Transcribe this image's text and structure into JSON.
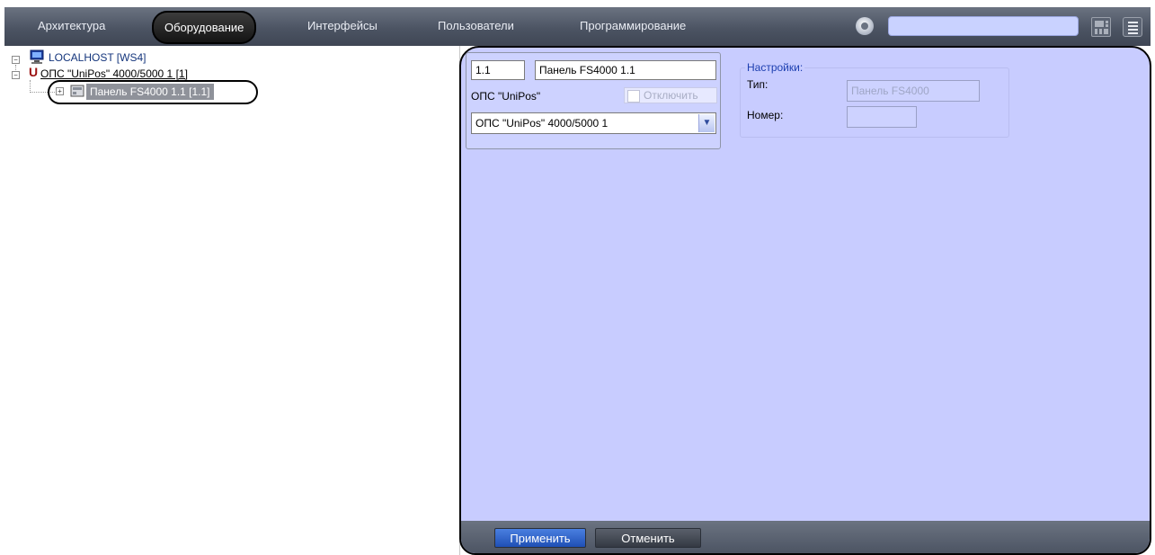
{
  "topbar": {
    "tabs": [
      {
        "label": "Архитектура"
      },
      {
        "label": "Оборудование"
      },
      {
        "label": "Интерфейсы"
      },
      {
        "label": "Пользователи"
      },
      {
        "label": "Программирование"
      }
    ],
    "search_value": ""
  },
  "tree": {
    "root": "LOCALHOST [WS4]",
    "child": "ОПС \"UniPos\" 4000/5000 1 [1]",
    "grandchild": "Панель FS4000 1.1 [1.1]"
  },
  "form": {
    "id_value": "1.1",
    "name_value": "Панель FS4000 1.1",
    "type_label": "ОПС \"UniPos\"",
    "disable_label": "Отключить",
    "parent_value": "ОПС \"UniPos\" 4000/5000 1",
    "settings": {
      "title": "Настройки:",
      "type_label": "Тип:",
      "type_value": "Панель FS4000",
      "number_label": "Номер:",
      "number_value": ""
    }
  },
  "buttons": {
    "apply": "Применить",
    "cancel": "Отменить"
  },
  "colors": {
    "bar": "#4c5463",
    "panel": "#c8ccff",
    "accent": "#1f4fb5"
  }
}
